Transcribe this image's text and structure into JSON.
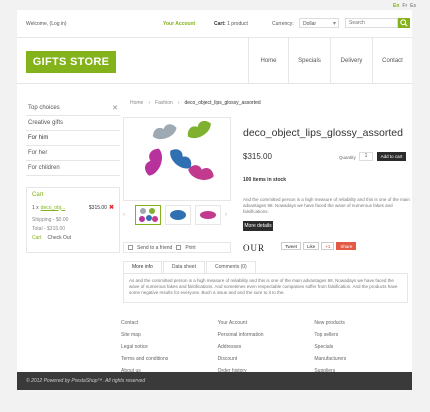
{
  "languages": [
    "En",
    "Fr",
    "Es"
  ],
  "topbar": {
    "welcome": "Welcome, (Log in)",
    "account": "Your Account",
    "cart_label": "Cart:",
    "cart_count": "1 product",
    "currency_label": "Currency:",
    "currency_value": "Dollar",
    "search_placeholder": "Search"
  },
  "logo": "GIFTS STORE",
  "nav": [
    "Home",
    "Specials",
    "Delivery",
    "Contact"
  ],
  "categories": [
    {
      "label": "Top choices",
      "has_close": true
    },
    {
      "label": "Creative gifts",
      "has_close": false
    },
    {
      "label": "For him",
      "has_close": false
    },
    {
      "label": "For her",
      "has_close": false
    },
    {
      "label": "For children",
      "has_close": false
    }
  ],
  "cart_block": {
    "title": "Cart",
    "qty": "1 x",
    "product": "deco_obj...",
    "amount": "$315.00",
    "shipping": "Shipping - $0.00",
    "total": "Total - $315.00",
    "cart_link": "Cart",
    "checkout_link": "Check Out"
  },
  "breadcrumb": [
    "Home",
    "Fashion",
    "deco_object_lips_glossy_assorted"
  ],
  "product": {
    "title": "deco_object_lips_glossy_assorted",
    "price": "$315.00",
    "quantity_label": "Quantity",
    "quantity": "1",
    "add_to_cart": "Add to cart",
    "stock": "100 items in stock",
    "description": "And the committed person is a high measure of reliability and this is one of the main advantages 98. Nowadays we have faced the wave of numerous fakes and falsifications.",
    "more_details": "More details",
    "zoom_text": "OUR",
    "colors": [
      "#9ea9b2",
      "#7fb02e",
      "#b8329d",
      "#2f6fb2",
      "#c13a8d"
    ]
  },
  "actions": {
    "send": "Send to a friend",
    "print": "Print"
  },
  "social": [
    "Tweet",
    "Like",
    "+1",
    "Share"
  ],
  "tabs": [
    "More info",
    "Data sheet",
    "Comments (0)"
  ],
  "tab_content": "As and the committed person is a high measure of reliability and this is one of the main advantages 98. Nowadays we have faced the wave of numerous fakes and falsifications. And sometimes even respectable companies suffer from falsification. And the products have some negative results for everyone. Buch a issue and and the sure to it to the.",
  "footer": [
    [
      "Contact",
      "Site map",
      "Legal notice",
      "Terms and conditions",
      "About us"
    ],
    [
      "Your Account",
      "Personal information",
      "Addresses",
      "Discount",
      "Order history"
    ],
    [
      "New products",
      "Top sellers",
      "Specials",
      "Manufacturers",
      "Suppliers"
    ]
  ],
  "copyright": "© 2012 Powered by PrestaShop™. All rights reserved"
}
